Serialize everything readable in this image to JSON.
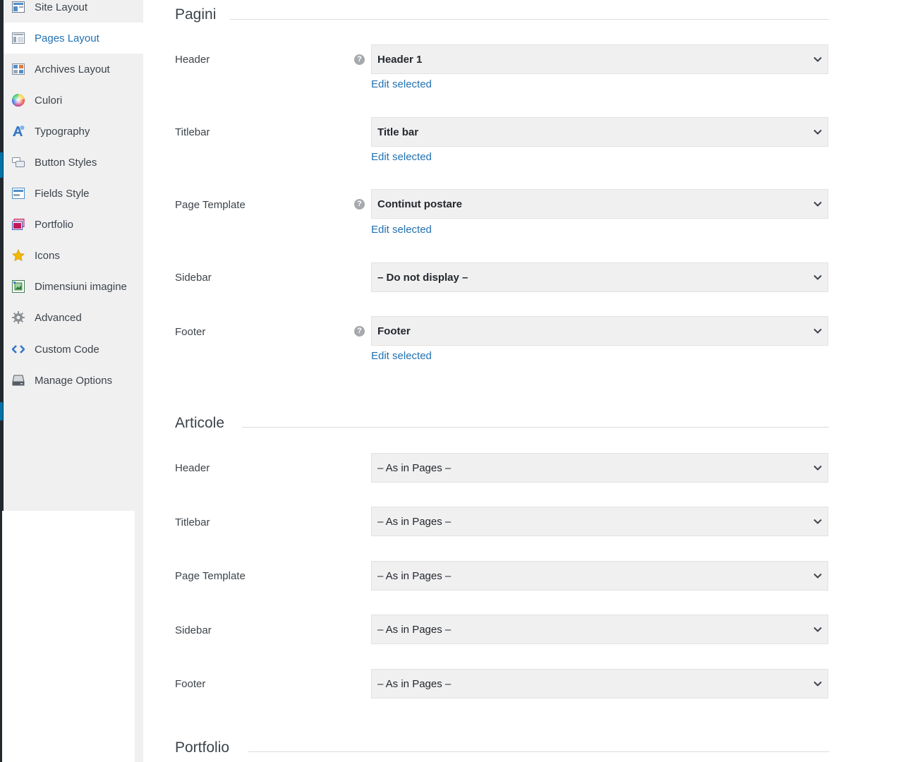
{
  "sidebar": {
    "items": [
      {
        "label": "Site Layout",
        "icon": "site-layout-icon"
      },
      {
        "label": "Pages Layout",
        "icon": "pages-layout-icon",
        "active": true
      },
      {
        "label": "Archives Layout",
        "icon": "archives-layout-icon"
      },
      {
        "label": "Culori",
        "icon": "color-wheel-icon"
      },
      {
        "label": "Typography",
        "icon": "typography-icon"
      },
      {
        "label": "Button Styles",
        "icon": "button-styles-icon"
      },
      {
        "label": "Fields Style",
        "icon": "fields-style-icon"
      },
      {
        "label": "Portfolio",
        "icon": "portfolio-icon"
      },
      {
        "label": "Icons",
        "icon": "star-icon"
      },
      {
        "label": "Dimensiuni imagine",
        "icon": "image-dimensions-icon"
      },
      {
        "label": "Advanced",
        "icon": "gear-icon"
      },
      {
        "label": "Custom Code",
        "icon": "code-icon"
      },
      {
        "label": "Manage Options",
        "icon": "manage-options-icon"
      }
    ]
  },
  "pages_section": {
    "title": "Pagini",
    "fields": [
      {
        "label": "Header",
        "value": "Header 1",
        "help": true,
        "edit": "Edit selected"
      },
      {
        "label": "Titlebar",
        "value": "Title bar",
        "help": false,
        "edit": "Edit selected"
      },
      {
        "label": "Page Template",
        "value": "Continut postare",
        "help": true,
        "edit": "Edit selected"
      },
      {
        "label": "Sidebar",
        "value": "– Do not display –",
        "help": false,
        "edit": ""
      },
      {
        "label": "Footer",
        "value": "Footer",
        "help": true,
        "edit": "Edit selected"
      }
    ]
  },
  "articles_section": {
    "title": "Articole",
    "fields": [
      {
        "label": "Header",
        "value": "– As in Pages –"
      },
      {
        "label": "Titlebar",
        "value": "– As in Pages –"
      },
      {
        "label": "Page Template",
        "value": "– As in Pages –"
      },
      {
        "label": "Sidebar",
        "value": "– As in Pages –"
      },
      {
        "label": "Footer",
        "value": "– As in Pages –"
      }
    ]
  },
  "portfolio_section": {
    "title": "Portfolio"
  },
  "colors": {
    "link": "#2271b1",
    "sidebar_bg": "#f0f0f1",
    "select_bg": "#f0f0f1",
    "admin_dark": "#23282d"
  }
}
